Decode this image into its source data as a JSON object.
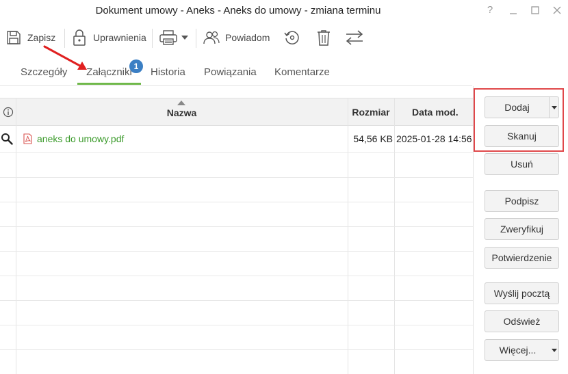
{
  "window": {
    "title": "Dokument umowy - Aneks - Aneks do umowy - zmiana terminu",
    "help": "?"
  },
  "toolbar": {
    "save": "Zapisz",
    "permissions": "Uprawnienia",
    "notify": "Powiadom"
  },
  "tabs": [
    {
      "label": "Szczegóły"
    },
    {
      "label": "Załączniki",
      "badge": "1"
    },
    {
      "label": "Historia"
    },
    {
      "label": "Powiązania"
    },
    {
      "label": "Komentarze"
    }
  ],
  "table": {
    "columns": {
      "name": "Nazwa",
      "size": "Rozmiar",
      "modified": "Data mod."
    },
    "rows": [
      {
        "name": "aneks do umowy.pdf",
        "size": "54,56 KB",
        "modified": "2025-01-28 14:56"
      }
    ]
  },
  "actions": {
    "add": "Dodaj",
    "scan": "Skanuj",
    "remove": "Usuń",
    "sign": "Podpisz",
    "verify": "Zweryfikuj",
    "confirm": "Potwierdzenie",
    "mail": "Wyślij pocztą",
    "refresh": "Odśwież",
    "more": "Więcej..."
  },
  "colors": {
    "accent": "#6fb84a",
    "link": "#3a9a2a",
    "badge": "#3b7fc4",
    "highlight": "#e0474a"
  }
}
